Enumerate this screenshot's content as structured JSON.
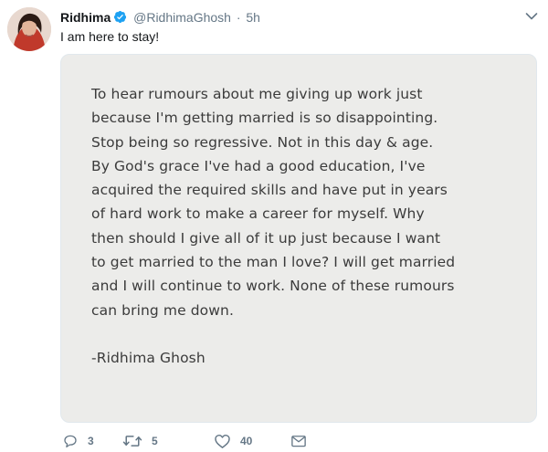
{
  "tweet": {
    "name": "Ridhima",
    "handle": "@RidhimaGhosh",
    "separator": "·",
    "time": "5h",
    "text": "I am here to stay!"
  },
  "note": {
    "lines": [
      "To hear rumours about me giving up work just",
      "because I'm getting married is so disappointing.",
      "Stop being so regressive. Not in this day & age.",
      "By God's grace I've had a good education, I've",
      "acquired the required skills and have put in years",
      "of hard work to make a career for myself. Why",
      "then should I give all of it up just because I want",
      "to get married to the man I love? I will get married",
      "and I will continue to work. None of these rumours",
      "can bring me down."
    ],
    "signature": "-Ridhima Ghosh"
  },
  "actions": {
    "reply_count": "3",
    "retweet_count": "5",
    "like_count": "40"
  },
  "icons": {
    "verified": "verified-badge-icon",
    "caret": "chevron-down-icon",
    "reply": "reply-icon",
    "retweet": "retweet-icon",
    "like": "heart-icon",
    "dm": "envelope-icon"
  },
  "colors": {
    "verified": "#1da1f2",
    "muted": "#657786",
    "text": "#14171a",
    "note_bg": "#ececea",
    "note_text": "#3b3b3b"
  }
}
